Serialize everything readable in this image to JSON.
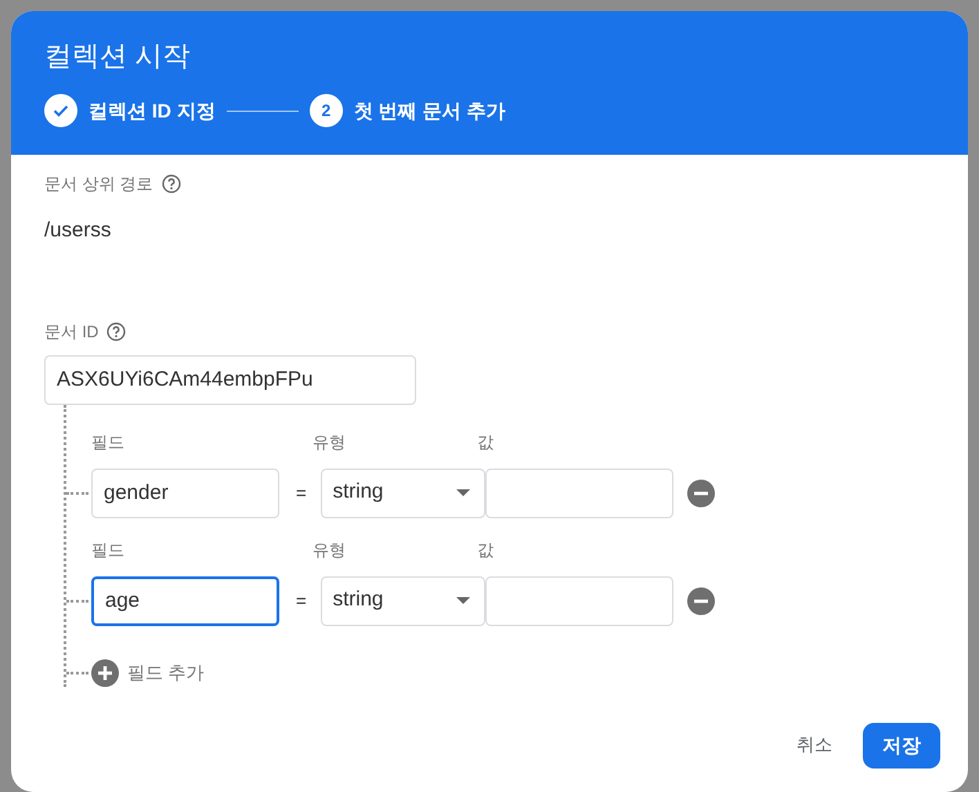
{
  "dialog": {
    "title": "컬렉션 시작",
    "steps": [
      {
        "label": "컬렉션 ID 지정",
        "completed": true
      },
      {
        "label": "첫 번째 문서 추가",
        "number": "2",
        "completed": false
      }
    ],
    "parent_path": {
      "label": "문서 상위 경로",
      "value": "/userss"
    },
    "document_id": {
      "label": "문서 ID",
      "value": "ASX6UYi6CAm44embpFPu"
    },
    "fields": [
      {
        "field_label": "필드",
        "type_label": "유형",
        "value_label": "값",
        "name": "gender",
        "equals": "=",
        "type": "string",
        "focused": false
      },
      {
        "field_label": "필드",
        "type_label": "유형",
        "value_label": "값",
        "name": "age",
        "equals": "=",
        "type": "string",
        "focused": true
      }
    ],
    "add_field": "필드 추가",
    "buttons": [
      {
        "label": "취소",
        "kind": "text"
      },
      {
        "label": "저장",
        "kind": "primary"
      }
    ]
  }
}
